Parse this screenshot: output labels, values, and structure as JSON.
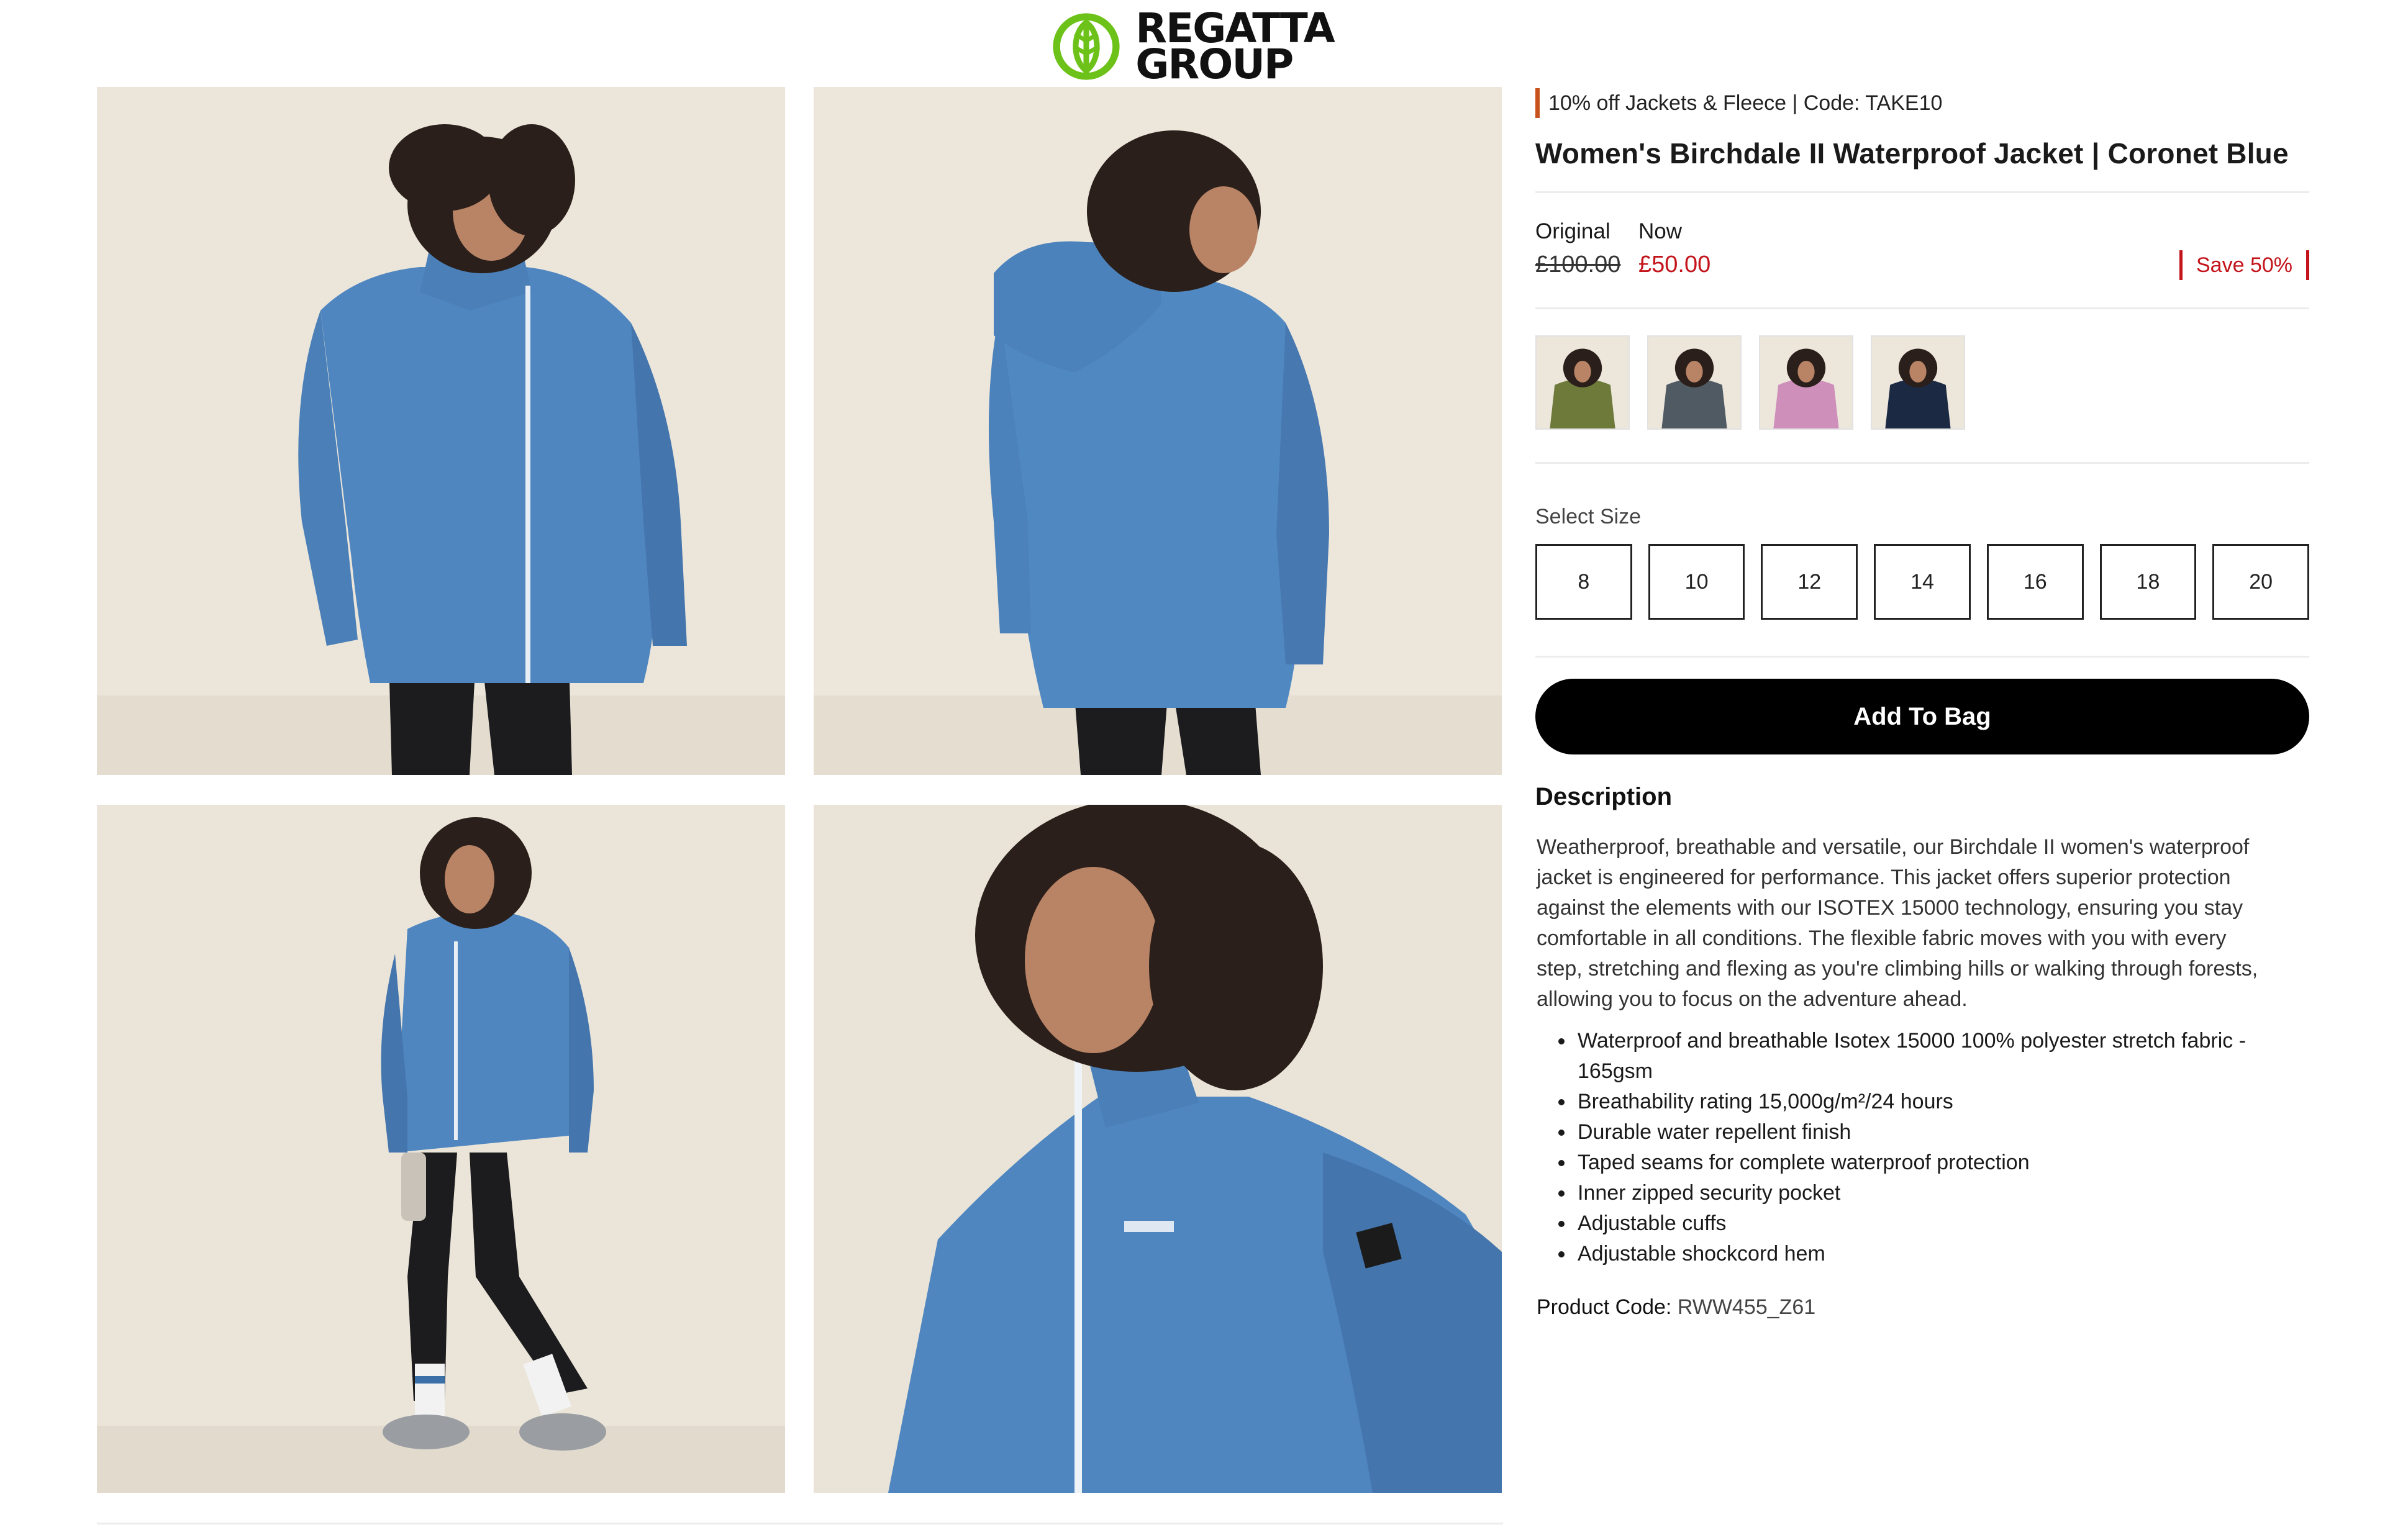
{
  "brand": {
    "logo_line1": "REGATTA",
    "logo_line2": "GROUP",
    "logo_color": "#6cc218"
  },
  "gallery": {
    "images": [
      {
        "name": "front-view",
        "alt": "Model wearing blue jacket, front view"
      },
      {
        "name": "back-view",
        "alt": "Model wearing blue jacket, back view with hood"
      },
      {
        "name": "full-length-view",
        "alt": "Model wearing blue jacket, full length side view"
      },
      {
        "name": "collar-detail-view",
        "alt": "Close-up of jacket collar and chest logo"
      }
    ],
    "jacket_color": "#4f86c0"
  },
  "product": {
    "promo": "10% off Jackets & Fleece | Code: TAKE10",
    "title": "Women's Birchdale II Waterproof Jacket | Coronet Blue",
    "price": {
      "original_label": "Original",
      "original_value": "£100.00",
      "now_label": "Now",
      "now_value": "£50.00",
      "save_text": "Save 50%"
    },
    "colour_swatches": [
      {
        "name": "olive",
        "color": "#6d7a3a"
      },
      {
        "name": "grey",
        "color": "#4f5a63"
      },
      {
        "name": "pink",
        "color": "#cf8fbb"
      },
      {
        "name": "navy",
        "color": "#1c2942"
      }
    ],
    "size_label": "Select Size",
    "sizes": [
      "8",
      "10",
      "12",
      "14",
      "16",
      "18",
      "20"
    ],
    "add_to_bag": "Add To Bag",
    "description_heading": "Description",
    "description": "Weatherproof, breathable and versatile, our Birchdale II women's waterproof jacket is engineered for performance. This jacket offers superior protection against the elements with our ISOTEX 15000 technology, ensuring you stay comfortable in all conditions. The flexible fabric moves with you with every step, stretching and flexing as you're climbing hills or walking through forests, allowing you to focus on the adventure ahead.",
    "features": [
      "Waterproof and breathable Isotex 15000 100% polyester stretch fabric - 165gsm",
      "Breathability rating 15,000g/m²/24 hours",
      "Durable water repellent finish",
      "Taped seams for complete waterproof protection",
      "Inner zipped security pocket",
      "Adjustable cuffs",
      "Adjustable shockcord hem"
    ],
    "product_code_label": "Product Code:",
    "product_code": "RWW455_Z61"
  }
}
